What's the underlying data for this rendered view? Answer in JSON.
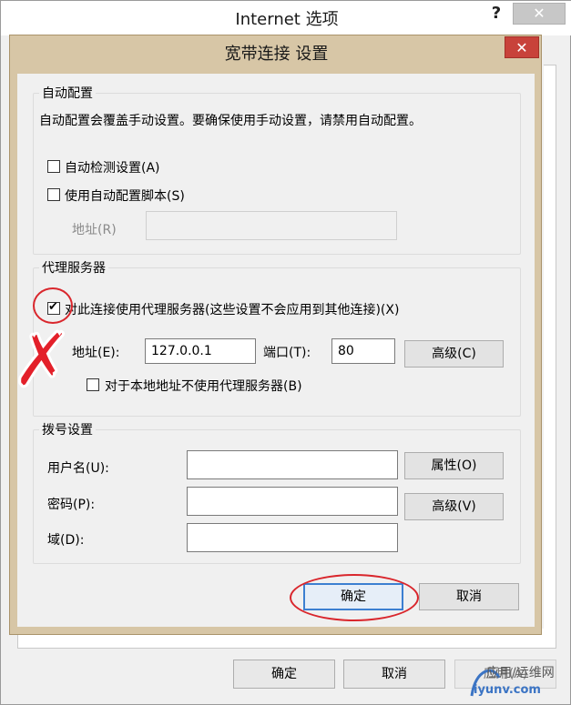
{
  "outer_window": {
    "title": "Internet 选项",
    "help_label": "?",
    "close_label": "✕",
    "buttons": {
      "ok": "确定",
      "cancel": "取消",
      "apply": "应用(A)"
    }
  },
  "dialog": {
    "title": "宽带连接 设置",
    "close_label": "✕",
    "auto_config": {
      "legend": "自动配置",
      "description": "自动配置会覆盖手动设置。要确保使用手动设置，请禁用自动配置。",
      "auto_detect": {
        "label": "自动检测设置(A)",
        "checked": false
      },
      "use_script": {
        "label": "使用自动配置脚本(S)",
        "checked": false
      },
      "address_label": "地址(R)",
      "address_value": ""
    },
    "proxy": {
      "legend": "代理服务器",
      "use_proxy": {
        "label": "对此连接使用代理服务器(这些设置不会应用到其他连接)(X)",
        "checked": true
      },
      "address_label": "地址(E):",
      "address_value": "127.0.0.1",
      "port_label": "端口(T):",
      "port_value": "80",
      "advanced_label": "高级(C)",
      "bypass_local": {
        "label": "对于本地地址不使用代理服务器(B)",
        "checked": false
      }
    },
    "dialup": {
      "legend": "拨号设置",
      "username_label": "用户名(U):",
      "username_value": "",
      "password_label": "密码(P):",
      "password_value": "",
      "domain_label": "域(D):",
      "domain_value": "",
      "properties_label": "属性(O)",
      "advanced_label": "高级(V)"
    },
    "buttons": {
      "ok": "确定",
      "cancel": "取消"
    }
  },
  "annotations": {
    "red_x": "✗",
    "highlight_color": "#d9262c"
  },
  "watermark": {
    "top": "应用/运维网",
    "bottom": "iyunv.com"
  }
}
